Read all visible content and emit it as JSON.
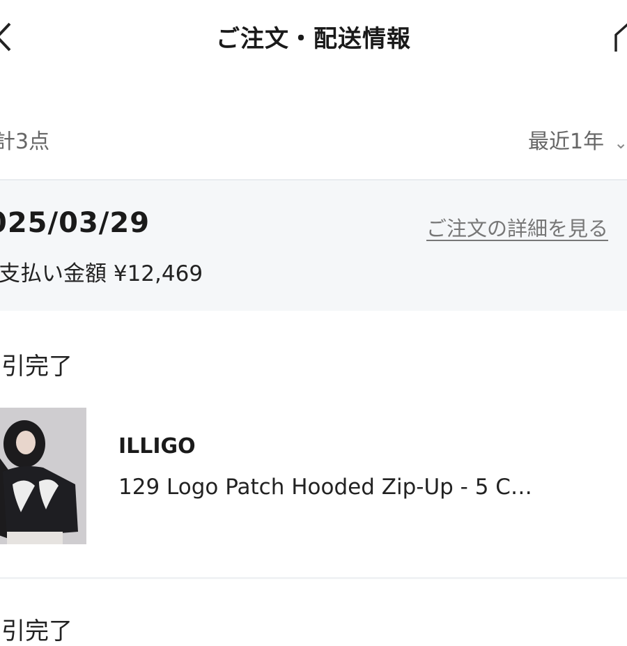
{
  "header": {
    "title": "ご注文・配送情報",
    "back_icon": "chevron-left-icon",
    "home_icon": "home-icon"
  },
  "summary": {
    "total_count": "計3点",
    "period": "最近1年"
  },
  "order": {
    "date": "025/03/29",
    "detail_link": "ご注文の詳細を見る",
    "payment_label": "支払い金額",
    "payment_amount": "¥12,469",
    "items": [
      {
        "status": "引完了",
        "brand": "ILLIGO",
        "name": "129 Logo Patch Hooded Zip-Up - 5 C…"
      }
    ],
    "next_status": "引完了"
  },
  "colors": {
    "order_header_bg": "#f5f7f9",
    "link_gray": "#777777"
  }
}
